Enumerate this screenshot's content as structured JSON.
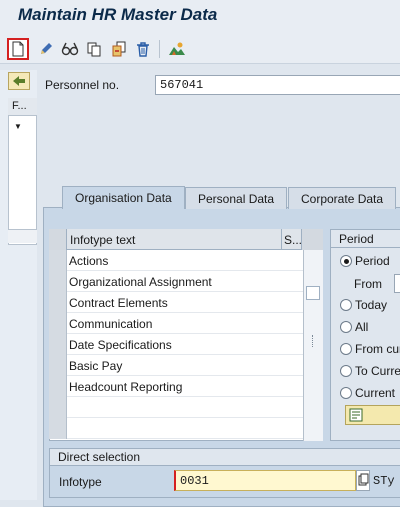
{
  "window": {
    "title": "Maintain HR Master Data"
  },
  "toolbar": {
    "buttons": [
      {
        "name": "create-icon"
      },
      {
        "name": "change-icon"
      },
      {
        "name": "display-icon"
      },
      {
        "name": "copy-icon"
      },
      {
        "name": "delimit-icon"
      },
      {
        "name": "delete-icon"
      },
      {
        "name": "overview-icon"
      }
    ]
  },
  "left_pane": {
    "header": "F...",
    "row_marker": "▼"
  },
  "personnel": {
    "label": "Personnel no.",
    "value": "567041"
  },
  "tabs": [
    {
      "label": "Organisation Data",
      "active": true
    },
    {
      "label": "Personal Data",
      "active": false
    },
    {
      "label": "Corporate Data",
      "active": false
    }
  ],
  "infotype_table": {
    "col_text": "Infotype text",
    "col_status": "S...",
    "rows": [
      "Actions",
      "Organizational Assignment",
      "Contract Elements",
      "Communication",
      "Date Specifications",
      "Basic Pay",
      "Headcount Reporting",
      "",
      ""
    ]
  },
  "period": {
    "title": "Period",
    "from_label": "From",
    "options": [
      {
        "label": "Period",
        "selected": true
      },
      {
        "label": "Today",
        "selected": false
      },
      {
        "label": "All",
        "selected": false
      },
      {
        "label": "From cur",
        "selected": false
      },
      {
        "label": "To Curre",
        "selected": false
      },
      {
        "label": "Current",
        "selected": false
      }
    ]
  },
  "direct_selection": {
    "title": "Direct selection",
    "infotype_label": "Infotype",
    "infotype_value": "0031",
    "sty_label": "STy"
  }
}
